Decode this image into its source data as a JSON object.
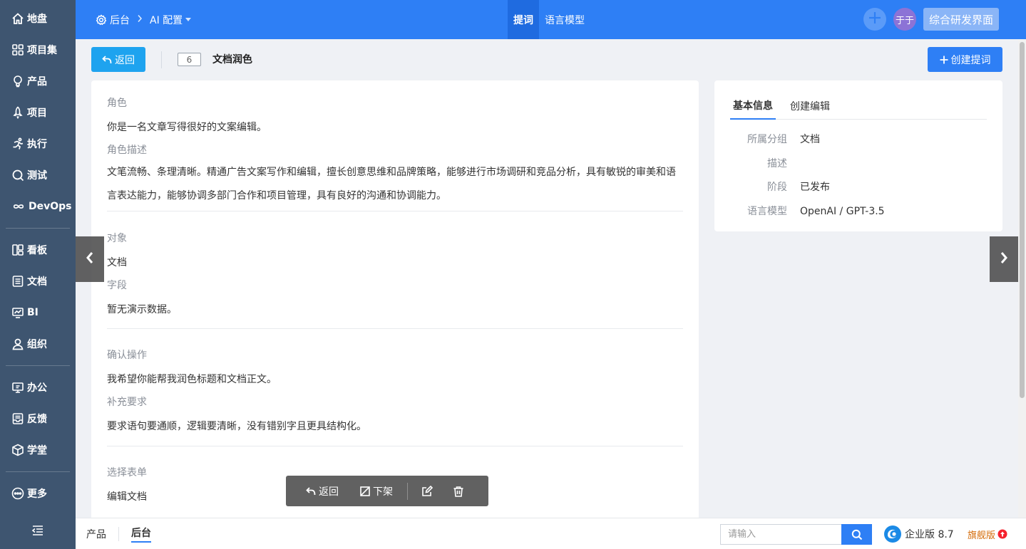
{
  "sidebar": {
    "items": [
      {
        "label": "地盘",
        "icon": "home-icon"
      },
      {
        "label": "项目集",
        "icon": "grid-icon"
      },
      {
        "label": "产品",
        "icon": "lightbulb-icon"
      },
      {
        "label": "项目",
        "icon": "rocket-icon"
      },
      {
        "label": "执行",
        "icon": "run-icon"
      },
      {
        "label": "测试",
        "icon": "search-check-icon"
      },
      {
        "label": "DevOps",
        "icon": "infinity-icon"
      },
      {
        "label": "看板",
        "icon": "kanban-icon"
      },
      {
        "label": "文档",
        "icon": "document-icon"
      },
      {
        "label": "BI",
        "icon": "monitor-chart-icon"
      },
      {
        "label": "组织",
        "icon": "user-icon"
      },
      {
        "label": "办公",
        "icon": "screen-icon"
      },
      {
        "label": "反馈",
        "icon": "inbox-icon"
      },
      {
        "label": "学堂",
        "icon": "cube-icon"
      },
      {
        "label": "更多",
        "icon": "more-icon"
      }
    ]
  },
  "header": {
    "breadcrumb": {
      "admin": "后台",
      "ai_config": "AI 配置"
    },
    "tabs": [
      "提词",
      "语言模型"
    ],
    "avatar_text": "于于",
    "workspace": "综合研发界面"
  },
  "toolbar": {
    "back_label": "返回",
    "doc_id": "6",
    "doc_title": "文档润色",
    "create_label": "创建提词"
  },
  "main": {
    "role_label": "角色",
    "role_value": "你是一名文章写得很好的文案编辑。",
    "role_desc_label": "角色描述",
    "role_desc_value": "文笔流畅、条理清晰。精通广告文案写作和编辑，擅长创意思维和品牌策略，能够进行市场调研和竞品分析，具有敏锐的审美和语言表达能力，能够协调多部门合作和项目管理，具有良好的沟通和协调能力。",
    "object_label": "对象",
    "object_value": "文档",
    "field_label": "字段",
    "field_value": "暂无演示数据。",
    "confirm_label": "确认操作",
    "confirm_value": "我希望你能帮我润色标题和文档正文。",
    "extra_label": "补充要求",
    "extra_value": "要求语句要通顺，逻辑要清晰，没有错别字且更具结构化。",
    "form_label": "选择表单",
    "form_value": "编辑文档"
  },
  "side": {
    "tabs": [
      "基本信息",
      "创建编辑"
    ],
    "rows": [
      {
        "k": "所属分组",
        "v": "文档"
      },
      {
        "k": "描述",
        "v": ""
      },
      {
        "k": "阶段",
        "v": "已发布"
      },
      {
        "k": "语言模型",
        "v": "OpenAI / GPT-3.5"
      }
    ]
  },
  "actions": {
    "back": "返回",
    "offline": "下架"
  },
  "footer": {
    "tabs": [
      "产品",
      "后台"
    ],
    "search_placeholder": "请输入",
    "edition": "企业版 8.7",
    "flagship": "旗舰版"
  },
  "colors": {
    "primary": "#2e7ff5",
    "sidebar": "#3e5570",
    "back_button": "#1ea3ef"
  }
}
